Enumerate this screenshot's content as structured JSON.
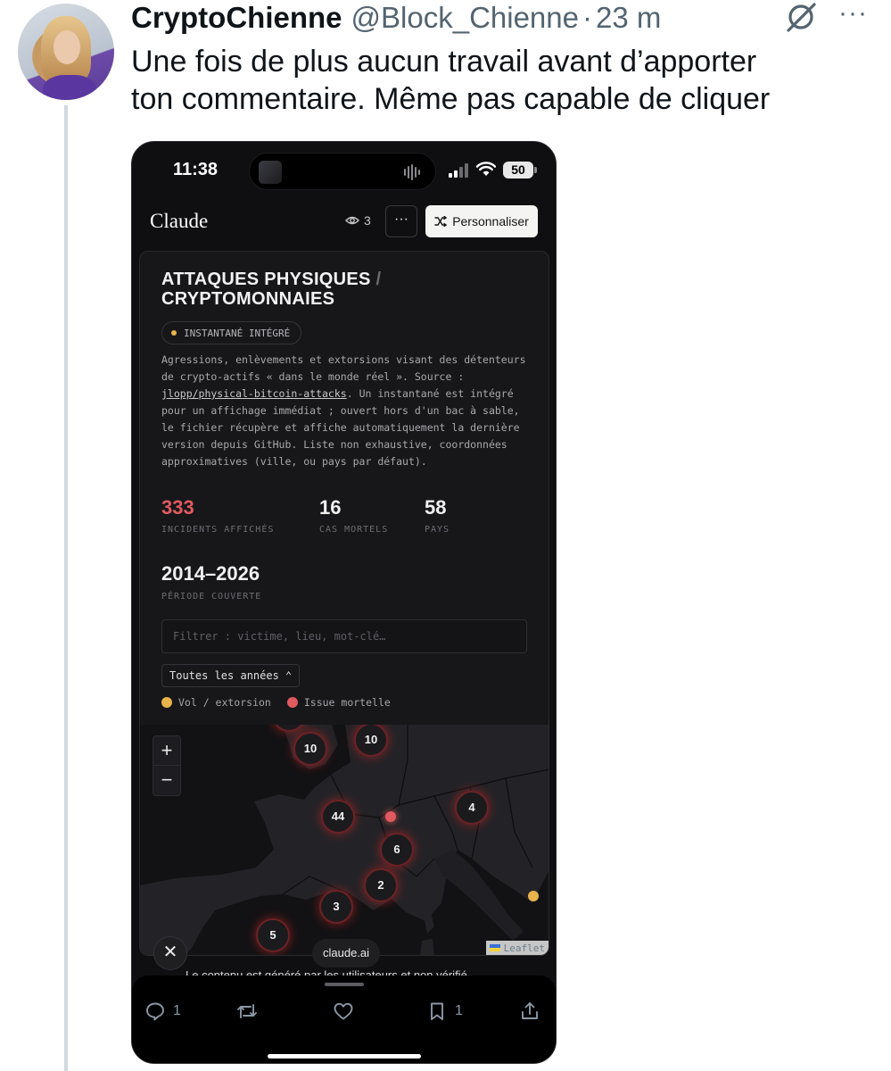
{
  "tweet": {
    "author_name": "CryptoChienne",
    "author_handle": "@Block_Chienne",
    "separator": "·",
    "time_ago": "23 m",
    "text_line1": "Une fois de plus aucun travail avant d’apporter",
    "text_line2": "ton commentaire. Même pas capable de cliquer",
    "more_label": "···"
  },
  "phone": {
    "status": {
      "clock": "11:38",
      "battery": "50"
    },
    "app_bar": {
      "brand": "Claude",
      "views": "3",
      "more_label": "···",
      "personalize_label": "Personnaliser"
    },
    "artifact": {
      "title_line1": "ATTAQUES PHYSIQUES",
      "title_slash": " /",
      "title_line2": "CRYPTOMONNAIES",
      "badge": "INSTANTANÉ INTÉGRÉ",
      "desc_before_link": "Agressions, enlèvements et extorsions visant des détenteurs de crypto-actifs « dans le monde réel ». Source : ",
      "desc_link": "jlopp/physical-bitcoin-attacks",
      "desc_after_link": ". Un instantané est intégré pour un affichage immédiat ; ouvert hors d'un bac à sable, le fichier récupère et affiche automatiquement la dernière version depuis GitHub. Liste non exhaustive, coordonnées approximatives (ville, ou pays par défaut).",
      "stats": [
        {
          "value": "333",
          "label": "INCIDENTS AFFICHÉS"
        },
        {
          "value": "16",
          "label": "CAS MORTELS"
        },
        {
          "value": "58",
          "label": "PAYS"
        }
      ],
      "period": {
        "value": "2014–2026",
        "label": "PÉRIODE COUVERTE"
      },
      "filter_placeholder": "Filtrer : victime, lieu, mot-clé…",
      "year_select": "Toutes les années ⌃",
      "legend": [
        {
          "label": "Vol / extorsion",
          "color": "#e7b34a"
        },
        {
          "label": "Issue mortelle",
          "color": "#e05a5f"
        }
      ],
      "map": {
        "zoom_in": "+",
        "zoom_out": "−",
        "clusters": [
          "10",
          "10",
          "44",
          "4",
          "6",
          "2",
          "3",
          "5"
        ],
        "attribution": "Leaflet"
      }
    },
    "close_label": "✕",
    "domain_chip": "claude.ai",
    "disclaimer": "Le contenu est généré par les utilisateurs et non vérifié",
    "actions": {
      "reply_count": "1",
      "bookmark_count": "1"
    }
  }
}
